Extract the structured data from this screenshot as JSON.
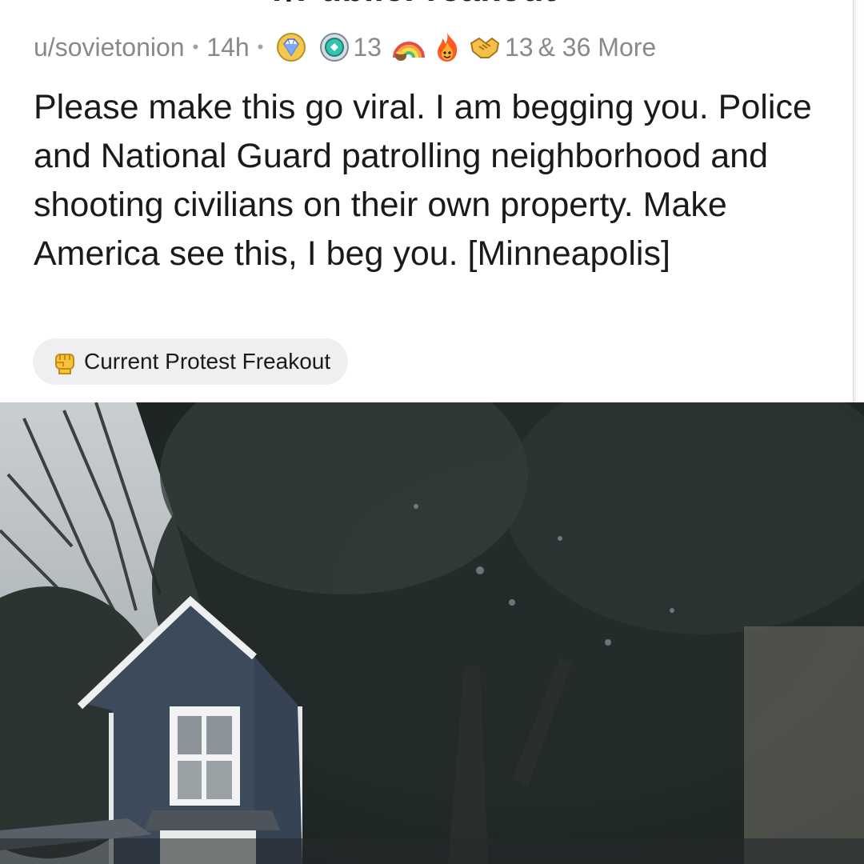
{
  "subreddit": {
    "title": "r/PublicFreakout"
  },
  "post": {
    "author": "u/sovietonion",
    "age": "14h",
    "awards": [
      {
        "icon": "gold-diamond-award-icon",
        "count": ""
      },
      {
        "icon": "platinum-seal-award-icon",
        "count": "13"
      },
      {
        "icon": "rainbow-award-icon",
        "count": ""
      },
      {
        "icon": "fire-face-award-icon",
        "count": ""
      },
      {
        "icon": "handshake-award-icon",
        "count": "13"
      }
    ],
    "more_awards": "& 36 More",
    "title": "Please make this go viral. I am begging you. Police and National Guard patrolling neighborhood and shooting civilians on their own property. Make America see this, I beg you. [Minneapolis]",
    "flair": {
      "icon": "raised-fist-icon",
      "label": "Current Protest Freakout"
    }
  },
  "media": {
    "type": "video",
    "icon": "video-frame-house-trees"
  },
  "colors": {
    "meta_text": "#878a8c",
    "title_text": "#1a1a1b",
    "flair_bg": "#edeff1",
    "house": "#3d4a5c"
  }
}
